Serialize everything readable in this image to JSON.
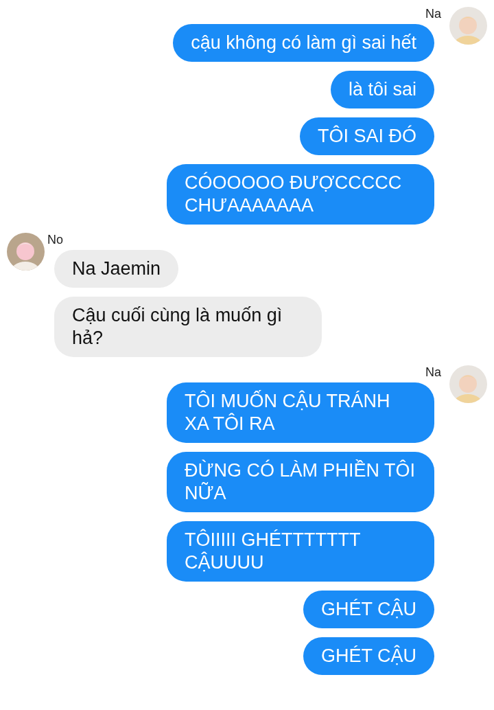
{
  "groups": [
    {
      "kind": "outgoing",
      "sender": "Na",
      "messages": [
        "cậu không có làm gì sai hết",
        "là tôi sai",
        "TÔI SAI ĐÓ",
        "CÓOOOOO ĐƯỢCCCCC CHƯAAAAAAA"
      ]
    },
    {
      "kind": "incoming",
      "sender": "No",
      "messages": [
        "Na Jaemin",
        "Cậu cuối cùng là muốn gì hả?"
      ]
    },
    {
      "kind": "outgoing",
      "sender": "Na",
      "messages": [
        "TÔI MUỐN CẬU TRÁNH XA TÔI RA",
        "ĐỪNG CÓ LÀM PHIỀN TÔI NỮA",
        "TÔIIIII GHÉTTTTTTT CẬUUUU",
        "GHÉT CẬU",
        "GHÉT CẬU"
      ]
    }
  ]
}
